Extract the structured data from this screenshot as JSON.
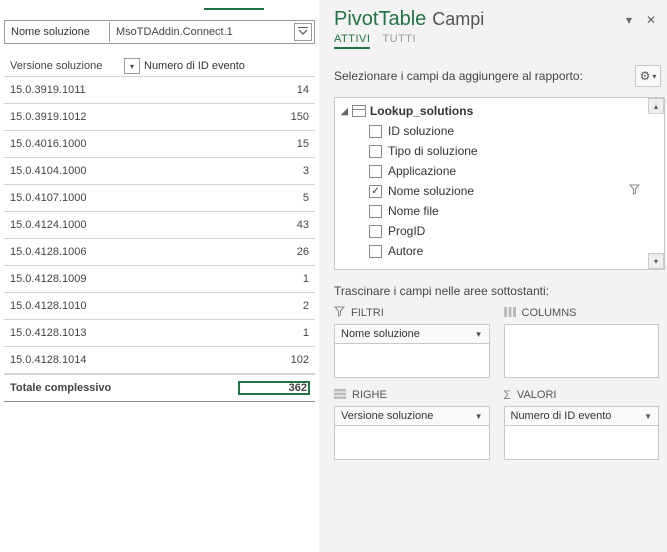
{
  "pivot": {
    "filter_label": "Nome soluzione",
    "filter_value": "MsoTDAddin.Connect.1",
    "row_header": "Versione soluzione",
    "value_header": "Numero di ID evento",
    "rows": [
      {
        "version": "15.0.3919.1011",
        "count": "14"
      },
      {
        "version": "15.0.3919.1012",
        "count": "150"
      },
      {
        "version": "15.0.4016.1000",
        "count": "15"
      },
      {
        "version": "15.0.4104.1000",
        "count": "3"
      },
      {
        "version": "15.0.4107.1000",
        "count": "5"
      },
      {
        "version": "15.0.4124.1000",
        "count": "43"
      },
      {
        "version": "15.0.4128.1006",
        "count": "26"
      },
      {
        "version": "15.0.4128.1009",
        "count": "1"
      },
      {
        "version": "15.0.4128.1010",
        "count": "2"
      },
      {
        "version": "15.0.4128.1013",
        "count": "1"
      },
      {
        "version": "15.0.4128.1014",
        "count": "102"
      }
    ],
    "grand_label": "Totale complessivo",
    "grand_value": "362"
  },
  "pane": {
    "title_strong": "PivotTable",
    "title_sub": "Campi",
    "tab_active": "ATTIVI",
    "tab_all": "TUTTI",
    "select_instruction": "Selezionare i campi da aggiungere al rapporto:",
    "table_name": "Lookup_solutions",
    "fields": [
      {
        "name": "ID soluzione",
        "checked": false,
        "filter": false
      },
      {
        "name": "Tipo di soluzione",
        "checked": false,
        "filter": false
      },
      {
        "name": "Applicazione",
        "checked": false,
        "filter": false
      },
      {
        "name": "Nome soluzione",
        "checked": true,
        "filter": true
      },
      {
        "name": "Nome file",
        "checked": false,
        "filter": false
      },
      {
        "name": "ProgID",
        "checked": false,
        "filter": false
      },
      {
        "name": "Autore",
        "checked": false,
        "filter": false
      }
    ],
    "drag_instruction": "Trascinare i campi nelle aree sottostanti:",
    "zones": {
      "filters_label": "FILTRI",
      "columns_label": "COLUMNS",
      "rows_label": "RIGHE",
      "values_label": "VALORI",
      "filters_item": "Nome soluzione",
      "rows_item": "Versione soluzione",
      "values_item": "Numero di ID evento"
    }
  }
}
